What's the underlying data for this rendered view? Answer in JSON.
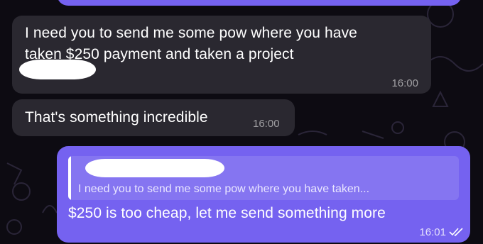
{
  "messages": [
    {
      "direction": "incoming",
      "text_line1": "I need you to send me some pow where you have",
      "text_line2": "taken $250 payment and taken a project",
      "time": "16:00"
    },
    {
      "direction": "incoming",
      "text": "That's something incredible",
      "time": "16:00"
    },
    {
      "direction": "outgoing",
      "reply_quote": "I need you to send me some pow where you have taken...",
      "text": "$250 is too cheap, let me send something more",
      "time": "16:01",
      "read_status_icon": "double-check-icon"
    }
  ],
  "colors": {
    "background": "#0d0b12",
    "incoming_bubble": "#2a2830",
    "outgoing_bubble": "#7562f0"
  }
}
